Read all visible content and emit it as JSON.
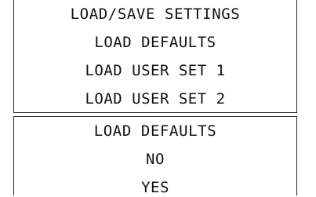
{
  "load_save_menu": {
    "title": "LOAD/SAVE SETTINGS",
    "items": [
      {
        "label": "LOAD DEFAULTS"
      },
      {
        "label": "LOAD USER SET 1"
      },
      {
        "label": "LOAD USER SET 2"
      }
    ]
  },
  "confirm_dialog": {
    "title": "LOAD DEFAULTS",
    "options": [
      {
        "label": "NO"
      },
      {
        "label": "YES"
      }
    ]
  }
}
